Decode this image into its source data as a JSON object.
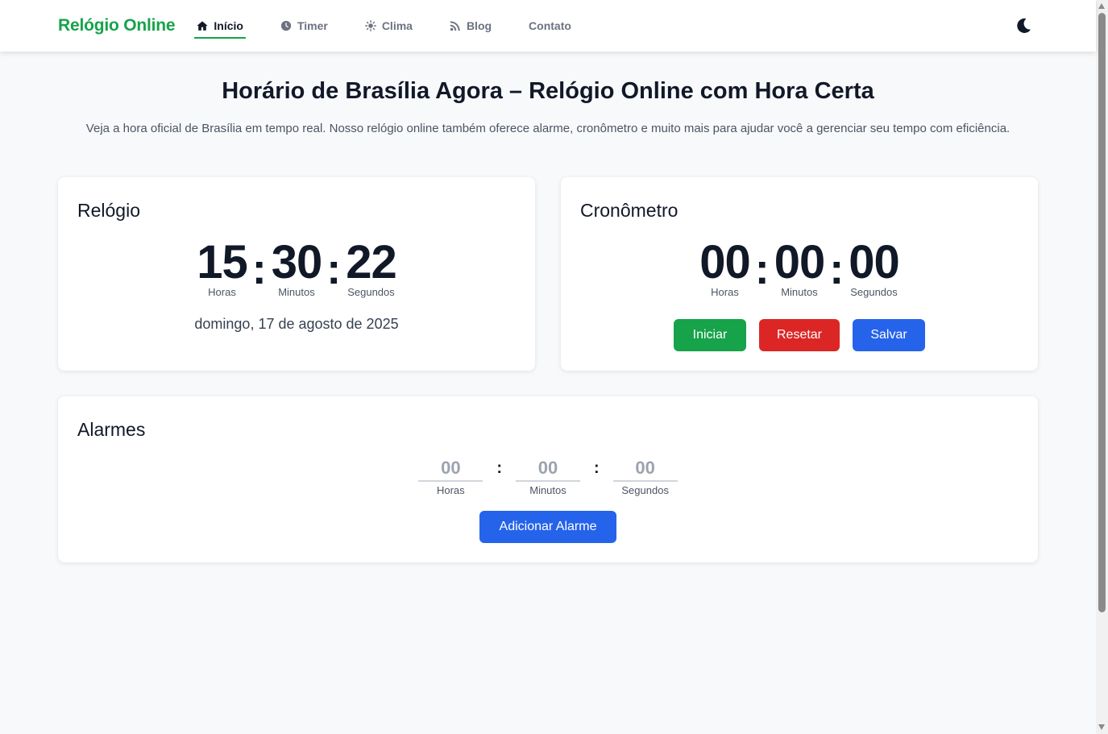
{
  "nav": {
    "brand": "Relógio Online",
    "links": [
      {
        "label": "Início",
        "icon": "home-icon"
      },
      {
        "label": "Timer",
        "icon": "clock-icon"
      },
      {
        "label": "Clima",
        "icon": "sun-icon"
      },
      {
        "label": "Blog",
        "icon": "rss-icon"
      },
      {
        "label": "Contato",
        "icon": ""
      }
    ],
    "active": "Início",
    "theme_icon": "moon-icon"
  },
  "hero": {
    "title": "Horário de Brasília Agora – Relógio Online com Hora Certa",
    "subtitle": "Veja a hora oficial de Brasília em tempo real. Nosso relógio online também oferece alarme, cronômetro e muito mais para ajudar você a gerenciar seu tempo com eficiência."
  },
  "clock": {
    "title": "Relógio",
    "hours": "15",
    "minutes": "30",
    "seconds": "22",
    "labels": {
      "hours": "Horas",
      "minutes": "Minutos",
      "seconds": "Segundos"
    },
    "date": "domingo, 17 de agosto de 2025"
  },
  "stopwatch": {
    "title": "Cronômetro",
    "hours": "00",
    "minutes": "00",
    "seconds": "00",
    "labels": {
      "hours": "Horas",
      "minutes": "Minutos",
      "seconds": "Segundos"
    },
    "buttons": {
      "start": "Iniciar",
      "reset": "Resetar",
      "save": "Salvar"
    }
  },
  "alarms": {
    "title": "Alarmes",
    "placeholders": {
      "hours": "00",
      "minutes": "00",
      "seconds": "00"
    },
    "labels": {
      "hours": "Horas",
      "minutes": "Minutos",
      "seconds": "Segundos"
    },
    "add_label": "Adicionar Alarme"
  },
  "colors": {
    "brand": "#16a34a",
    "start": "#16a34a",
    "reset": "#dc2626",
    "primary": "#2563eb",
    "background": "#f8f9fb"
  }
}
